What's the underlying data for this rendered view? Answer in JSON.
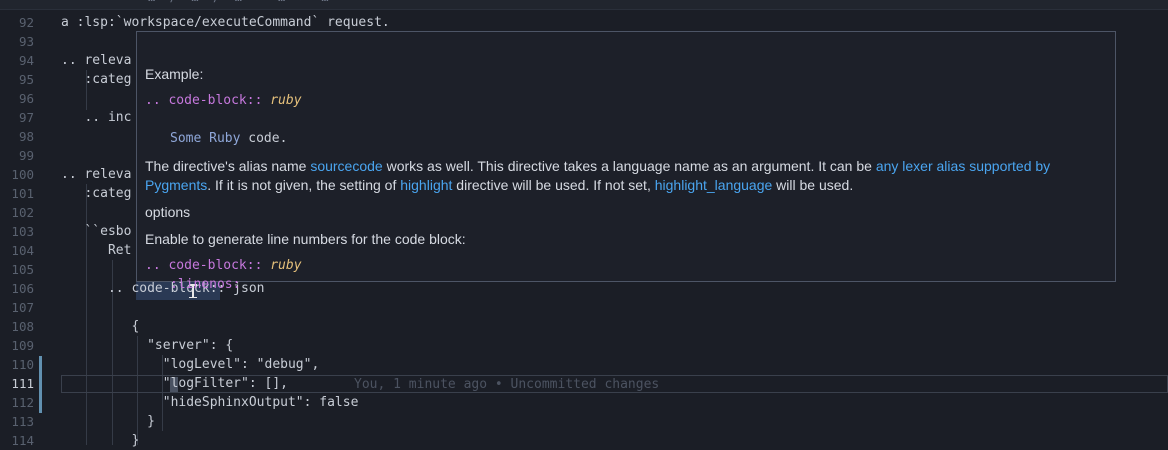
{
  "topbar": {
    "breadcrumb_fragment": "…  /  …  /  …  >  …  >  …"
  },
  "editor": {
    "lines": [
      {
        "n": "92",
        "text": "a :lsp:`workspace/executeCommand` request."
      },
      {
        "n": "93",
        "text": ""
      },
      {
        "n": "94",
        "text": ".. releva"
      },
      {
        "n": "95",
        "text": "   :categ"
      },
      {
        "n": "96",
        "text": ""
      },
      {
        "n": "97",
        "text": "   .. inc"
      },
      {
        "n": "98",
        "text": ""
      },
      {
        "n": "99",
        "text": ""
      },
      {
        "n": "100",
        "text": ".. releva"
      },
      {
        "n": "101",
        "text": "   :categ"
      },
      {
        "n": "102",
        "text": ""
      },
      {
        "n": "103",
        "text": "   ``esbo"
      },
      {
        "n": "104",
        "text": "      Ret"
      },
      {
        "n": "105",
        "text": ""
      },
      {
        "n": "106",
        "text": "      .. code-block:: json"
      },
      {
        "n": "107",
        "text": ""
      },
      {
        "n": "108",
        "text": "         {"
      },
      {
        "n": "109",
        "text": "           \"server\": {"
      },
      {
        "n": "110",
        "text": "             \"logLevel\": \"debug\","
      },
      {
        "n": "111",
        "text": "             \"logFilter\": [],"
      },
      {
        "n": "112",
        "text": "             \"hideSphinxOutput\": false"
      },
      {
        "n": "113",
        "text": "           }"
      },
      {
        "n": "114",
        "text": "         }"
      }
    ],
    "blame": "You, 1 minute ago • Uncommitted changes"
  },
  "hover": {
    "example_label": "Example:",
    "code1_prefix": ".. code-block::",
    "code1_lang": "ruby",
    "code1_body_a": "Some",
    "code1_body_b": "Ruby",
    "code1_body_c": "code.",
    "para1": {
      "t1": "The directive's alias name ",
      "l1": "sourcecode",
      "t2": " works as well. This directive takes a language name as an argument. It can be ",
      "l2": "any lexer alias supported by",
      "l3": "Pygments",
      "t3": ". If it is not given, the setting of ",
      "l4": "highlight",
      "t4": " directive will be used. If not set, ",
      "l5": "highlight_language",
      "t5": " will be used."
    },
    "options_heading": "options",
    "linenos_desc": "Enable to generate line numbers for the code block:",
    "code2_prefix": ".. code-block::",
    "code2_lang": "ruby",
    "code2_option": ":linenos:"
  },
  "colors": {
    "background": "#1b1e26",
    "link": "#4aa5f0",
    "keyword": "#c678dd",
    "lang": "#e5c07b"
  }
}
